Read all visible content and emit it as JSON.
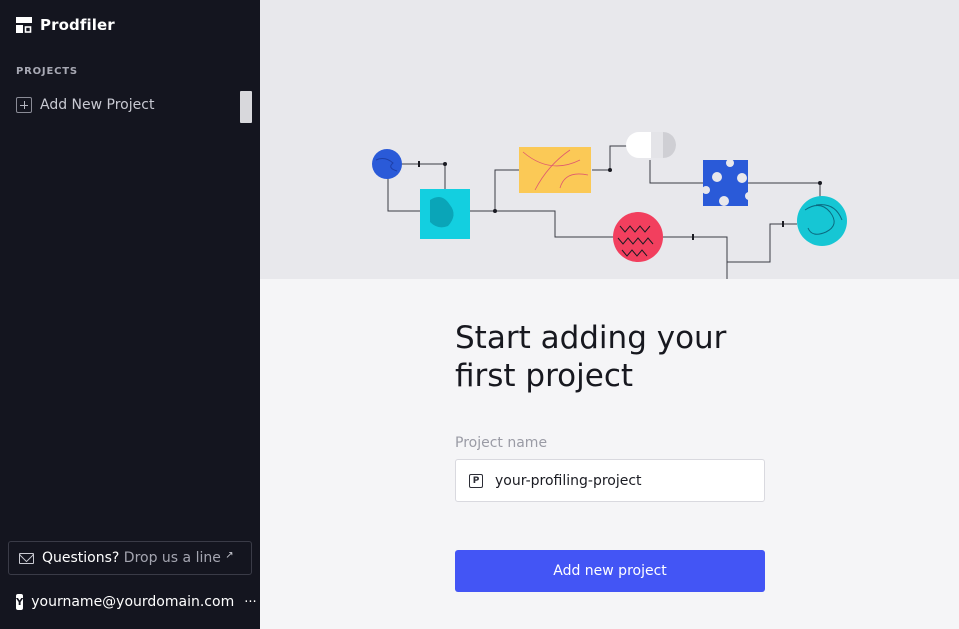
{
  "sidebar": {
    "brand_name": "Prodfiler",
    "section_label": "PROJECTS",
    "add_project_label": "Add New Project",
    "questions_label": "Questions?",
    "questions_link": "Drop us a line",
    "user_initial": "Y",
    "user_email": "yourname@yourdomain.com",
    "more_glyph": "···"
  },
  "main": {
    "title_line1": "Start adding your",
    "title_line2": "first project",
    "field_label": "Project name",
    "field_icon_letter": "P",
    "field_value": "your-profiling-project",
    "submit_label": "Add new project"
  },
  "colors": {
    "sidebar_bg": "#14151f",
    "accent": "#4355f5",
    "hero_bg": "#e8e8ec"
  },
  "icons": [
    "brand-logo-icon",
    "plus-icon",
    "mail-icon",
    "external-link-icon",
    "more-icon",
    "project-icon"
  ]
}
